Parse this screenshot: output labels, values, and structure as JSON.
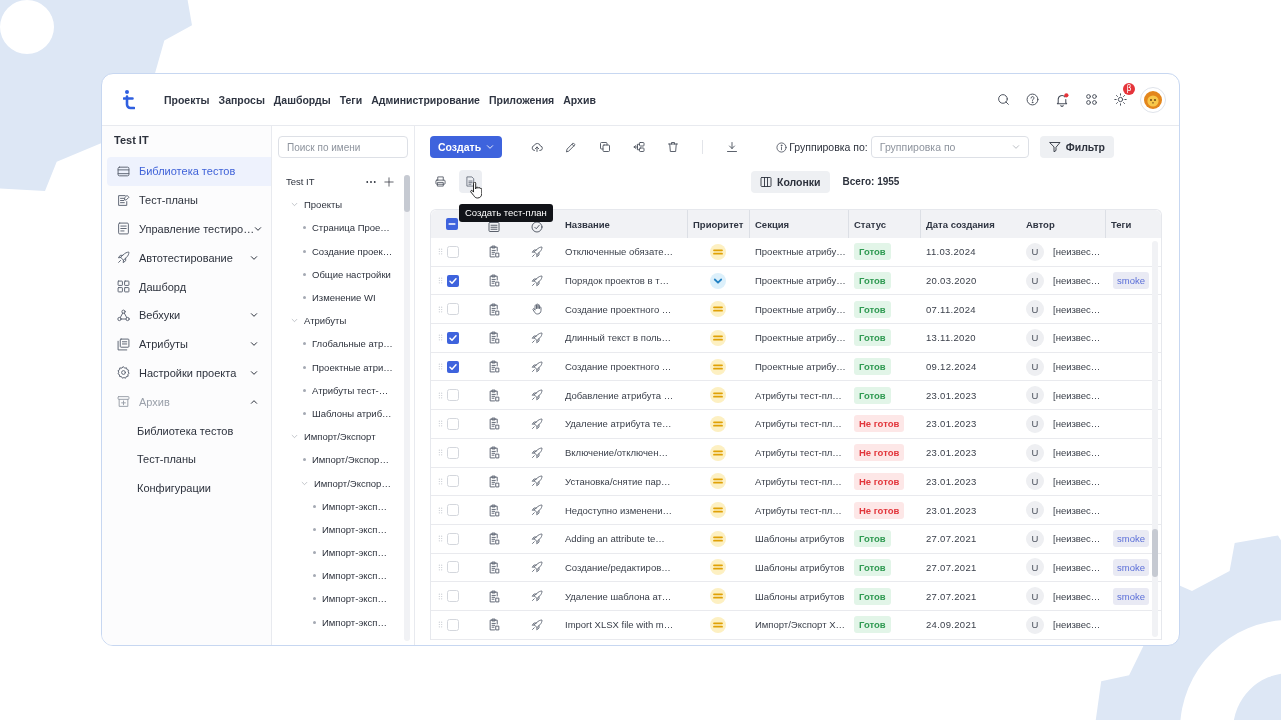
{
  "top_bar": {
    "nav": [
      "Проекты",
      "Запросы",
      "Дашборды",
      "Теги",
      "Администрирование",
      "Приложения",
      "Архив"
    ],
    "notifications_unread": true,
    "beta_badge": "β"
  },
  "sidebar": {
    "title": "Test IT",
    "items": [
      {
        "label": "Библиотека тестов",
        "kind": "page",
        "selected": true
      },
      {
        "label": "Тест-планы",
        "kind": "page",
        "selected": false
      },
      {
        "label": "Управление тестиро…",
        "kind": "group",
        "selected": false,
        "expanded": false
      },
      {
        "label": "Автотестирование",
        "kind": "group",
        "selected": false,
        "expanded": false
      },
      {
        "label": "Дашборд",
        "kind": "page",
        "selected": false
      },
      {
        "label": "Вебхуки",
        "kind": "group",
        "selected": false,
        "expanded": false
      },
      {
        "label": "Атрибуты",
        "kind": "group",
        "selected": false,
        "expanded": false
      },
      {
        "label": "Настройки проекта",
        "kind": "group",
        "selected": false,
        "expanded": false
      },
      {
        "label": "Архив",
        "kind": "group",
        "selected": false,
        "expanded": true,
        "children": [
          {
            "label": "Библиотека тестов",
            "selected": false
          },
          {
            "label": "Тест-планы",
            "selected": false
          },
          {
            "label": "Конфигурации",
            "selected": false
          }
        ]
      }
    ]
  },
  "tree": {
    "search": {
      "placeholder": "Поиск по имени"
    },
    "root": {
      "label": "Test IT",
      "children": [
        {
          "label": "Проекты",
          "expanded": true,
          "children": [
            {
              "label": "Страница Прое…"
            },
            {
              "label": "Создание проек…"
            },
            {
              "label": "Общие настройки"
            },
            {
              "label": "Изменение WI"
            }
          ]
        },
        {
          "label": "Атрибуты",
          "expanded": true,
          "children": [
            {
              "label": "Глобальные атр…"
            },
            {
              "label": "Проектные атри…"
            },
            {
              "label": "Атрибуты тест-…"
            },
            {
              "label": "Шаблоны атриб…"
            }
          ]
        },
        {
          "label": "Импорт/Экспорт",
          "expanded": true,
          "children": [
            {
              "label": "Импорт/Экспор…"
            },
            {
              "label": "Импорт/Экспор…",
              "expanded": true,
              "children": [
                {
                  "label": "Импорт-эксп…"
                },
                {
                  "label": "Импорт-эксп…"
                },
                {
                  "label": "Импорт-эксп…"
                },
                {
                  "label": "Импорт-эксп…"
                },
                {
                  "label": "Импорт-эксп…"
                },
                {
                  "label": "Импорт-эксп…"
                }
              ]
            }
          ]
        }
      ]
    }
  },
  "toolbar": {
    "create_button": "Создать",
    "grouping_label": "Группировка по:",
    "grouping_select": {
      "placeholder": "Группировка по"
    },
    "filter_button": "Фильтр",
    "columns_button": "Колонки",
    "total": "Всего: **1955**",
    "tooltip": "Создать тест-план"
  },
  "table": {
    "header_checkbox": {
      "checked": false,
      "mixed": true
    },
    "columns": [
      "Название",
      "Приоритет",
      "Секция",
      "Статус",
      "Дата создания",
      "Автор",
      "Теги"
    ],
    "rows": [
      {
        "selected": false,
        "kind": "automated",
        "title": "Отключенные обязате…",
        "priority": {
          "kind": "medium"
        },
        "section": "Проектные атрибу…",
        "status": {
          "text": "Готов",
          "kind": "ready"
        },
        "created": "11.03.2024",
        "author_initial": "U",
        "author": "[неизвес…"
      },
      {
        "selected": true,
        "kind": "automated",
        "title": "Порядок проектов в т…",
        "priority": {
          "kind": "low"
        },
        "section": "Проектные атрибу…",
        "status": {
          "text": "Готов",
          "kind": "ready"
        },
        "created": "20.03.2020",
        "author_initial": "U",
        "author": "[неизвес…",
        "tags": [
          "smoke"
        ]
      },
      {
        "selected": false,
        "kind": "manual",
        "title": "Создание проектного …",
        "priority": {
          "kind": "medium"
        },
        "section": "Проектные атрибу…",
        "status": {
          "text": "Готов",
          "kind": "ready"
        },
        "created": "07.11.2024",
        "author_initial": "U",
        "author": "[неизвес…"
      },
      {
        "selected": true,
        "kind": "automated",
        "title": "Длинный текст в поль…",
        "priority": {
          "kind": "medium"
        },
        "section": "Проектные атрибу…",
        "status": {
          "text": "Готов",
          "kind": "ready"
        },
        "created": "13.11.2020",
        "author_initial": "U",
        "author": "[неизвес…"
      },
      {
        "selected": true,
        "kind": "automated",
        "title": "Создание проектного …",
        "priority": {
          "kind": "medium"
        },
        "section": "Проектные атрибу…",
        "status": {
          "text": "Готов",
          "kind": "ready"
        },
        "created": "09.12.2024",
        "author_initial": "U",
        "author": "[неизвес…"
      },
      {
        "selected": false,
        "kind": "automated",
        "title": "Добавление атрибута …",
        "priority": {
          "kind": "medium"
        },
        "section": "Атрибуты тест-пл…",
        "status": {
          "text": "Готов",
          "kind": "ready"
        },
        "created": "23.01.2023",
        "author_initial": "U",
        "author": "[неизвес…"
      },
      {
        "selected": false,
        "kind": "automated",
        "title": "Удаление атрибута те…",
        "priority": {
          "kind": "medium"
        },
        "section": "Атрибуты тест-пл…",
        "status": {
          "text": "Не готов",
          "kind": "not_ready"
        },
        "created": "23.01.2023",
        "author_initial": "U",
        "author": "[неизвес…"
      },
      {
        "selected": false,
        "kind": "automated",
        "title": "Включение/отключен…",
        "priority": {
          "kind": "medium"
        },
        "section": "Атрибуты тест-пл…",
        "status": {
          "text": "Не готов",
          "kind": "not_ready"
        },
        "created": "23.01.2023",
        "author_initial": "U",
        "author": "[неизвес…"
      },
      {
        "selected": false,
        "kind": "automated",
        "title": "Установка/снятие пар…",
        "priority": {
          "kind": "medium"
        },
        "section": "Атрибуты тест-пл…",
        "status": {
          "text": "Не готов",
          "kind": "not_ready"
        },
        "created": "23.01.2023",
        "author_initial": "U",
        "author": "[неизвес…"
      },
      {
        "selected": false,
        "kind": "automated",
        "title": "Недоступно изменени…",
        "priority": {
          "kind": "medium"
        },
        "section": "Атрибуты тест-пл…",
        "status": {
          "text": "Не готов",
          "kind": "not_ready"
        },
        "created": "23.01.2023",
        "author_initial": "U",
        "author": "[неизвес…"
      },
      {
        "selected": false,
        "kind": "automated",
        "title": "Adding an attribute te…",
        "priority": {
          "kind": "medium"
        },
        "section": "Шаблоны атрибутов",
        "status": {
          "text": "Готов",
          "kind": "ready"
        },
        "created": "27.07.2021",
        "author_initial": "U",
        "author": "[неизвес…",
        "tags": [
          "smoke"
        ]
      },
      {
        "selected": false,
        "kind": "automated",
        "title": "Создание/редактиров…",
        "priority": {
          "kind": "medium"
        },
        "section": "Шаблоны атрибутов",
        "status": {
          "text": "Готов",
          "kind": "ready"
        },
        "created": "27.07.2021",
        "author_initial": "U",
        "author": "[неизвес…",
        "tags": [
          "smoke"
        ]
      },
      {
        "selected": false,
        "kind": "automated",
        "title": "Удаление шаблона ат…",
        "priority": {
          "kind": "medium"
        },
        "section": "Шаблоны атрибутов",
        "status": {
          "text": "Готов",
          "kind": "ready"
        },
        "created": "27.07.2021",
        "author_initial": "U",
        "author": "[неизвес…",
        "tags": [
          "smoke"
        ]
      },
      {
        "selected": false,
        "kind": "automated",
        "title": "Import XLSX file with m…",
        "priority": {
          "kind": "medium"
        },
        "section": "Импорт/Экспорт Х…",
        "status": {
          "text": "Готов",
          "kind": "ready"
        },
        "created": "24.09.2021",
        "author_initial": "U",
        "author": "[неизвес…"
      }
    ]
  }
}
